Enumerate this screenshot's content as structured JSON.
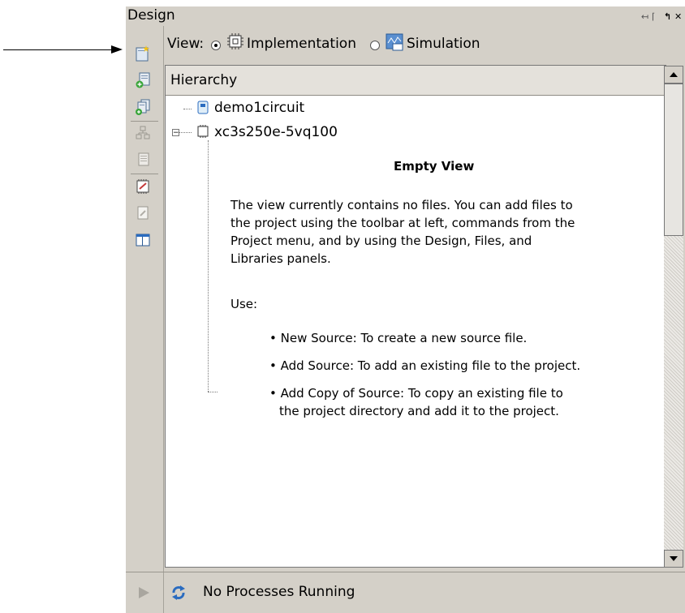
{
  "panel": {
    "title": "Design"
  },
  "view": {
    "label": "View:",
    "options": [
      {
        "label": "Implementation",
        "selected": true,
        "icon": "implementation-chip-icon"
      },
      {
        "label": "Simulation",
        "selected": false,
        "icon": "simulation-icon"
      }
    ]
  },
  "hierarchy": {
    "header": "Hierarchy",
    "items": [
      {
        "label": "demo1circuit",
        "icon": "project-file-icon"
      },
      {
        "label": "xc3s250e-5vq100",
        "icon": "chip-icon"
      }
    ]
  },
  "empty_view": {
    "title": "Empty View",
    "paragraph_lines": [
      "The view currently contains no files. You can add files to",
      "the project using the toolbar at left, commands from the",
      "Project menu, and by using the Design, Files, and",
      "Libraries panels."
    ],
    "use_label": "Use:",
    "bullets": [
      {
        "text": "New Source: To create a new source file."
      },
      {
        "text": "Add Source: To add an existing file to the project."
      },
      {
        "lines": [
          "Add Copy of Source: To copy an existing file to",
          "the project directory and add it to the project."
        ]
      }
    ]
  },
  "status": {
    "text": "No Processes Running"
  },
  "colors": {
    "panel_bg": "#d4d0c8",
    "accent_blue": "#2a6bbf"
  }
}
